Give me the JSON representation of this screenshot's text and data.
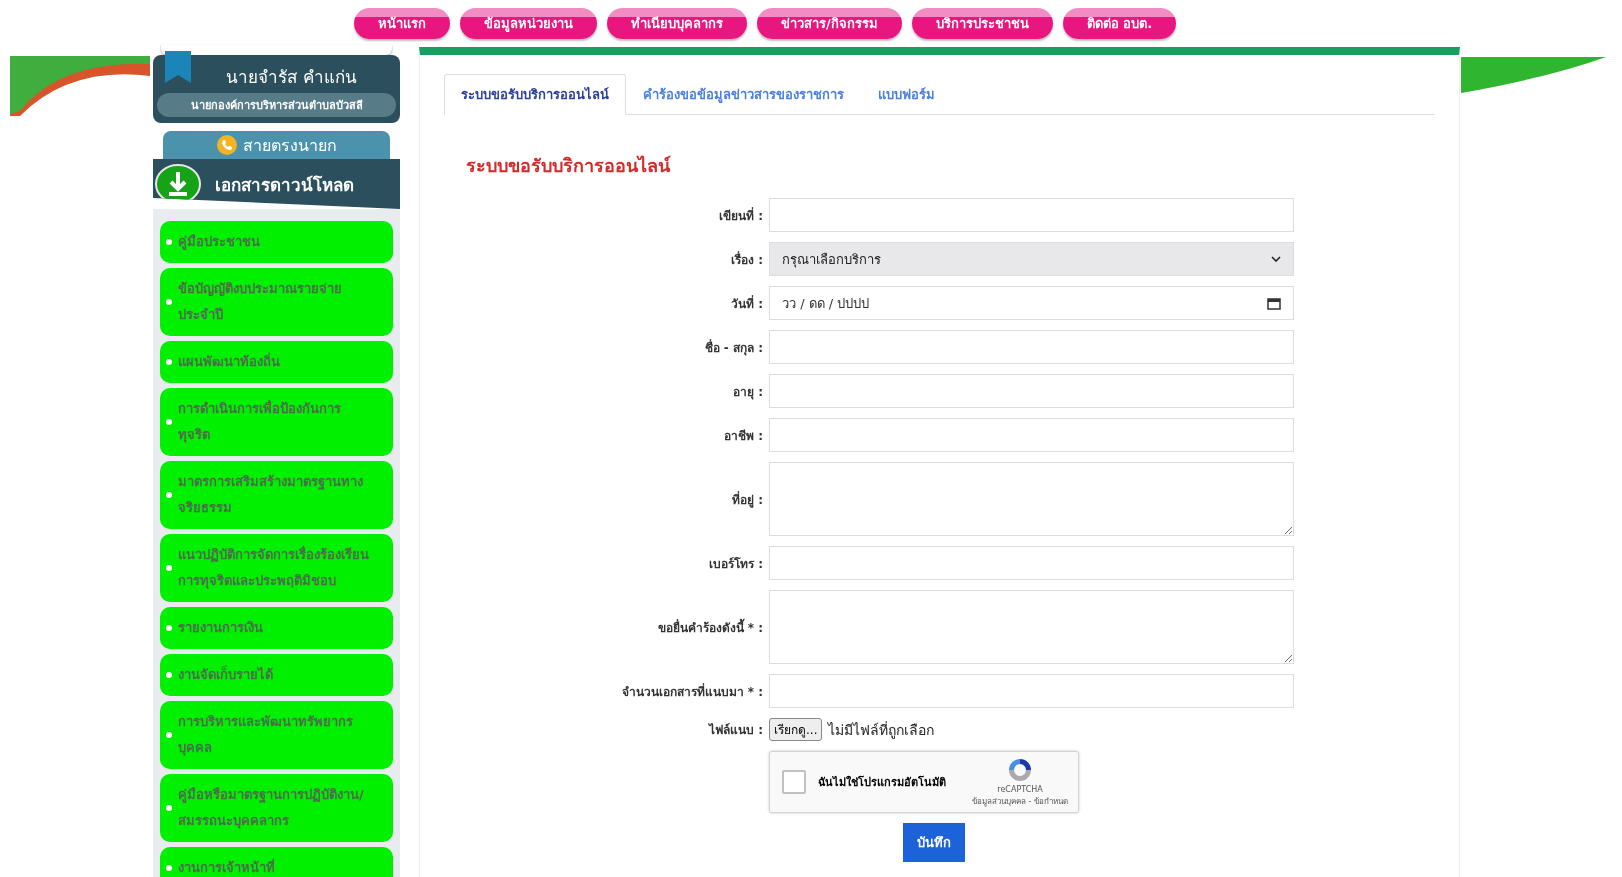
{
  "nav": [
    {
      "label": "หน้าแรก"
    },
    {
      "label": "ข้อมูลหน่วยงาน"
    },
    {
      "label": "ทำเนียบบุคลากร"
    },
    {
      "label": "ข่าวสาร/กิจกรรม"
    },
    {
      "label": "บริการประชาชน"
    },
    {
      "label": "ติดต่อ อบต."
    }
  ],
  "profile": {
    "name": "นายจำรัส คำแก่น",
    "title": "นายกองค์การบริหารส่วนตำบลบัวสลี"
  },
  "hotline": {
    "label": "สายตรงนายก"
  },
  "downloads": {
    "title": "เอกสารดาวน์โหลด",
    "items": [
      {
        "label": "คู่มือประชาชน"
      },
      {
        "label": "ข้อบัญญัติงบประมาณรายจ่ายประจำปี"
      },
      {
        "label": "แผนพัฒนาท้องถิ่น"
      },
      {
        "label": "การดำเนินการเพื่อป้องกันการทุจริต"
      },
      {
        "label": "มาตรการเสริมสร้างมาตรฐานทางจริยธรรม"
      },
      {
        "label": "แนวปฏิบัติการจัดการเรื่องร้องเรียนการทุจริตและประพฤติมิชอบ"
      },
      {
        "label": "รายงานการเงิน"
      },
      {
        "label": "งานจัดเก็บรายได้"
      },
      {
        "label": "การบริหารและพัฒนาทรัพยากรบุคคล"
      },
      {
        "label": "คู่มือหรือมาตรฐานการปฏิบัติงาน/สมรรถนะบุคคลากร"
      },
      {
        "label": "งานการเจ้าหน้าที่"
      }
    ]
  },
  "tabs": [
    {
      "label": "ระบบขอรับบริการออนไลน์",
      "selected": true
    },
    {
      "label": "คำร้องขอข้อมูลข่าวสารของราชการ",
      "selected": false
    },
    {
      "label": "แบบฟอร์ม",
      "selected": false
    }
  ],
  "form": {
    "heading": "ระบบขอรับบริการออนไลน์",
    "fields": [
      {
        "kind": "text",
        "label": "เขียนที่ :"
      },
      {
        "kind": "select",
        "label": "เรื่อง :",
        "value": "กรุณาเลือกบริการ"
      },
      {
        "kind": "date",
        "label": "วันที่ :",
        "placeholder": "วว / ดด / ปปปป"
      },
      {
        "kind": "text",
        "label": "ชื่อ - สกุล :"
      },
      {
        "kind": "text",
        "label": "อายุ :"
      },
      {
        "kind": "text",
        "label": "อาชีพ :"
      },
      {
        "kind": "textarea",
        "label": "ที่อยู่ :"
      },
      {
        "kind": "text",
        "label": "เบอร์โทร :"
      },
      {
        "kind": "textarea",
        "label": "ขอยื่นคำร้องดังนี้ * :"
      },
      {
        "kind": "text",
        "label": "จำนวนเอกสารที่แนบมา * :"
      }
    ],
    "file": {
      "label": "ไฟล์แนบ :",
      "button": "เรียกดู...",
      "status": "ไม่มีไฟล์ที่ถูกเลือก"
    },
    "captcha": {
      "label": "ฉันไม่ใช่โปรแกรมอัตโนมัติ",
      "checked": false,
      "brand": "reCAPTCHA",
      "links": "ข้อมูลส่วนบุคคล - ข้อกำหนด"
    },
    "submit": "บันทึก"
  }
}
